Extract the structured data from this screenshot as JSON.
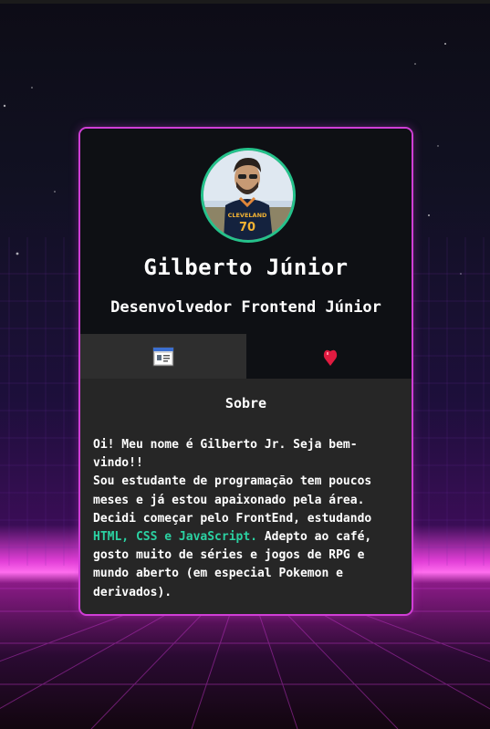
{
  "colors": {
    "card_border": "#d03ed6",
    "avatar_border": "#25c28b",
    "highlight": "#2bd1a2",
    "card_bg": "#262626",
    "card_header_bg": "#0e1014"
  },
  "profile": {
    "name": "Gilberto Júnior",
    "role": "Desenvolvedor Frontend Júnior",
    "avatar_icon": "profile-photo",
    "shirt_text": "CLEVELAND",
    "shirt_number": "70"
  },
  "tabs": [
    {
      "icon": "profile-card-icon",
      "active": true
    },
    {
      "icon": "heart-icon",
      "active": false
    }
  ],
  "about": {
    "title": "Sobre",
    "line1": "Oi! Meu nome é Gilberto Jr. Seja bem-",
    "line2": "vindo!!",
    "line3": "Sou estudante de programação tem poucos",
    "line4": "meses e já estou apaixonado pela área.",
    "line5": "Decidi começar pelo FrontEnd, estudando",
    "highlight": "HTML, CSS e JavaScript.",
    "line6_rest": " Adepto ao café,",
    "line7": "gosto muito de séries e jogos de RPG e",
    "line8": "mundo aberto (em especial Pokemon e",
    "line9": "derivados)."
  }
}
